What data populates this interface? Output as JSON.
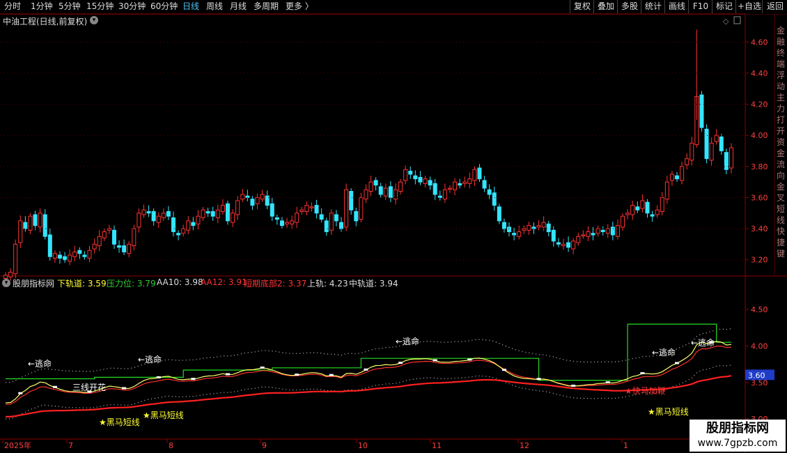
{
  "toolbar": {
    "periods": [
      "分时",
      "1分钟",
      "5分钟",
      "15分钟",
      "30分钟",
      "60分钟",
      "日线",
      "周线",
      "月线",
      "多周期",
      "更多 〉"
    ],
    "active_period": "日线",
    "right_buttons": [
      "复权",
      "叠加",
      "多股",
      "统计",
      "画线",
      "F10",
      "标记",
      "+自选",
      "返回"
    ]
  },
  "stock": {
    "title": "中油工程(日线,前复权)"
  },
  "price_axis": {
    "ticks": [
      "4.60",
      "4.40",
      "4.20",
      "4.00",
      "3.80",
      "3.60",
      "3.40",
      "3.20"
    ]
  },
  "side_panel": {
    "text": "金融终端 浮动 主力 打开 资金 流向 金叉 短线 快 捷 键"
  },
  "indicator": {
    "name": "股朋指标网",
    "values": [
      {
        "label": "下轨道:",
        "value": "3.59",
        "color": "#ffff33"
      },
      {
        "label": "压力位:",
        "value": "3.79",
        "color": "#33cc33"
      },
      {
        "label": "AA10:",
        "value": "3.98",
        "color": "#dddddd"
      },
      {
        "label": "AA12:",
        "value": "3.91",
        "color": "#ff3333"
      },
      {
        "label": "短期底部2:",
        "value": "3.37",
        "color": "#ff3333"
      },
      {
        "label": "上轨:",
        "value": "4.23",
        "color": "#dddddd"
      },
      {
        "label": "中轨道:",
        "value": "3.94",
        "color": "#dddddd"
      }
    ],
    "axis_ticks": [
      "4.50",
      "4.00",
      "3.50",
      "3.00"
    ],
    "current_badge": "3.60",
    "signals": {
      "escape": "←逃命",
      "three_lines": "三线开花",
      "dark_horse": "★黑马短线",
      "fast_horse": "★快马加鞭"
    }
  },
  "date_axis": [
    "2025年",
    "7",
    "8",
    "9",
    "10",
    "11",
    "12",
    "1"
  ],
  "logo": {
    "line1": "股朋指标网",
    "line2": "www.7gpzb.com"
  },
  "colors": {
    "up": "#ff3333",
    "down": "#33e5ff",
    "ma_yellow": "#ffff66",
    "pressure_green": "#22dd22",
    "bottom_red": "#ff2020",
    "grid": "#5a0000"
  },
  "chart_data": {
    "type": "candlestick",
    "y_range": [
      3.1,
      4.7
    ],
    "approx_closes": [
      3.1,
      3.12,
      3.3,
      3.45,
      3.4,
      3.48,
      3.42,
      3.5,
      3.35,
      3.22,
      3.24,
      3.21,
      3.2,
      3.23,
      3.25,
      3.24,
      3.22,
      3.26,
      3.3,
      3.35,
      3.38,
      3.4,
      3.3,
      3.28,
      3.25,
      3.3,
      3.4,
      3.5,
      3.52,
      3.5,
      3.45,
      3.48,
      3.5,
      3.48,
      3.38,
      3.36,
      3.4,
      3.45,
      3.42,
      3.48,
      3.52,
      3.5,
      3.48,
      3.52,
      3.55,
      3.45,
      3.5,
      3.58,
      3.62,
      3.6,
      3.55,
      3.6,
      3.62,
      3.55,
      3.48,
      3.46,
      3.42,
      3.44,
      3.45,
      3.5,
      3.52,
      3.55,
      3.54,
      3.5,
      3.46,
      3.38,
      3.5,
      3.45,
      3.4,
      3.65,
      3.52,
      3.45,
      3.6,
      3.65,
      3.7,
      3.68,
      3.62,
      3.66,
      3.6,
      3.65,
      3.7,
      3.78,
      3.75,
      3.72,
      3.7,
      3.72,
      3.68,
      3.62,
      3.6,
      3.65,
      3.66,
      3.7,
      3.68,
      3.7,
      3.72,
      3.78,
      3.72,
      3.66,
      3.62,
      3.55,
      3.45,
      3.4,
      3.38,
      3.36,
      3.38,
      3.4,
      3.42,
      3.4,
      3.42,
      3.44,
      3.38,
      3.32,
      3.3,
      3.3,
      3.28,
      3.32,
      3.35,
      3.36,
      3.38,
      3.36,
      3.4,
      3.38,
      3.4,
      3.36,
      3.42,
      3.48,
      3.5,
      3.55,
      3.52,
      3.58,
      3.5,
      3.48,
      3.52,
      3.6,
      3.7,
      3.75,
      3.72,
      3.8,
      3.85,
      3.95,
      4.25,
      4.05,
      3.85,
      3.95,
      4.0,
      3.9,
      3.78,
      3.92
    ],
    "indicator_lines": [
      "下轨道",
      "压力位",
      "AA10",
      "AA12",
      "短期底部2",
      "上轨",
      "中轨道"
    ]
  }
}
